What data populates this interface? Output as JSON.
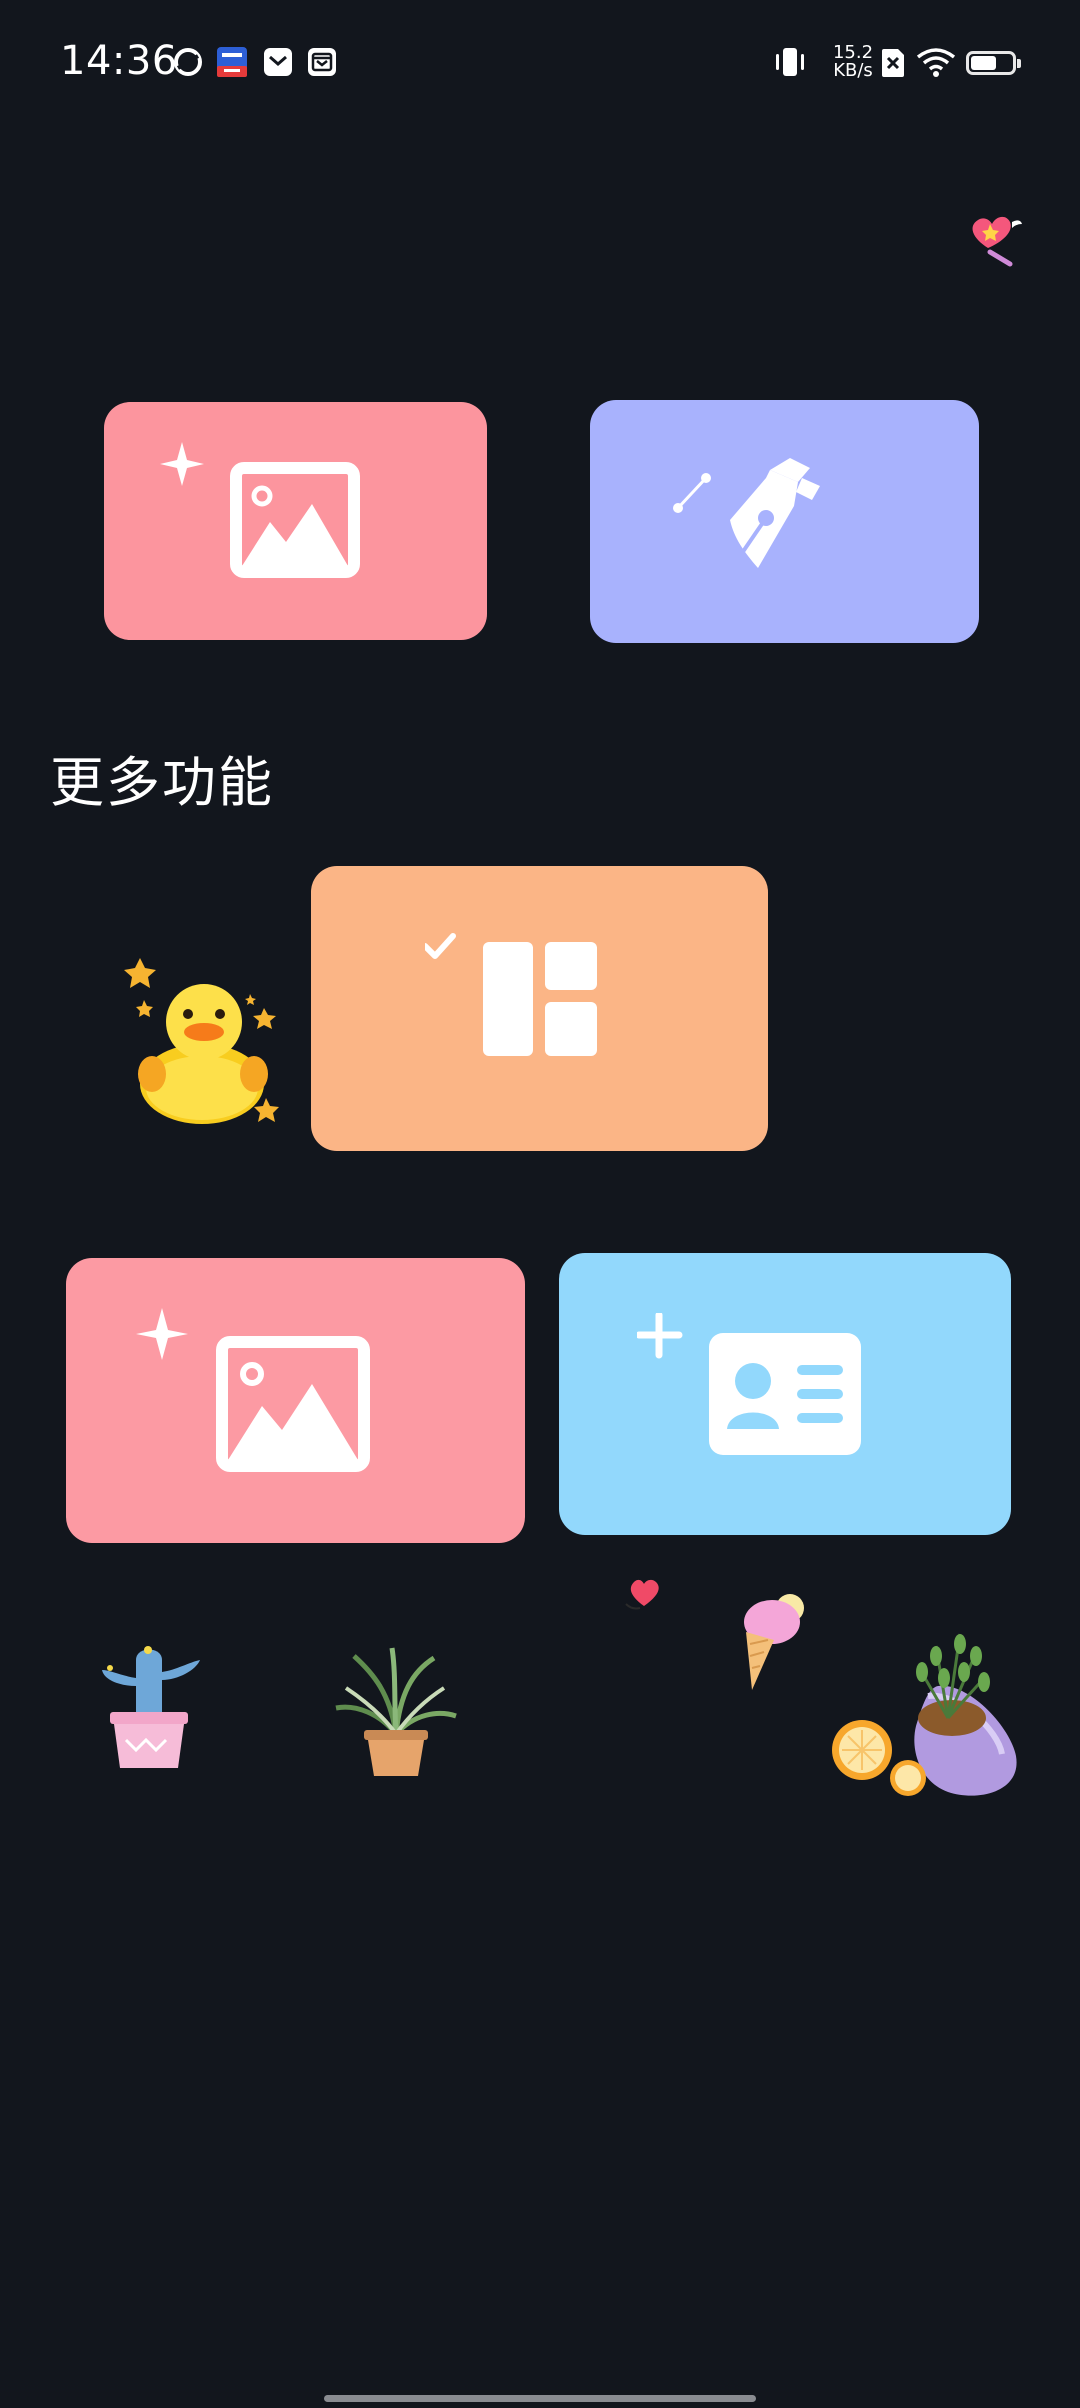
{
  "status_bar": {
    "time": "14:36",
    "net_speed_value": "15.2",
    "net_speed_unit": "KB/s",
    "battery_level": 0.62,
    "icons": [
      "chrome-like-icon",
      "app-badge-icon",
      "mail-icon",
      "inbox-icon",
      "vibrate-icon",
      "no-sim-icon",
      "wifi-icon",
      "battery-icon"
    ]
  },
  "cards": {
    "top_left": {
      "icon": "ai-image-icon",
      "color": "#fc959e"
    },
    "top_right": {
      "icon": "pen-tool-icon",
      "color": "#a8b2fd"
    },
    "middle": {
      "icon": "layout-check-icon",
      "color": "#fbb586"
    },
    "bottom_left": {
      "icon": "ai-image-icon",
      "color": "#fc9aa3"
    },
    "bottom_right": {
      "icon": "add-contact-card-icon",
      "color": "#92d8fc"
    }
  },
  "section": {
    "title": "更多功能"
  },
  "stickers": [
    "heart-wand-sticker",
    "duck-sticker",
    "cactus-sticker",
    "spider-plant-sticker",
    "heart-sticker",
    "ice-cream-sticker",
    "plant-vase-sticker"
  ]
}
